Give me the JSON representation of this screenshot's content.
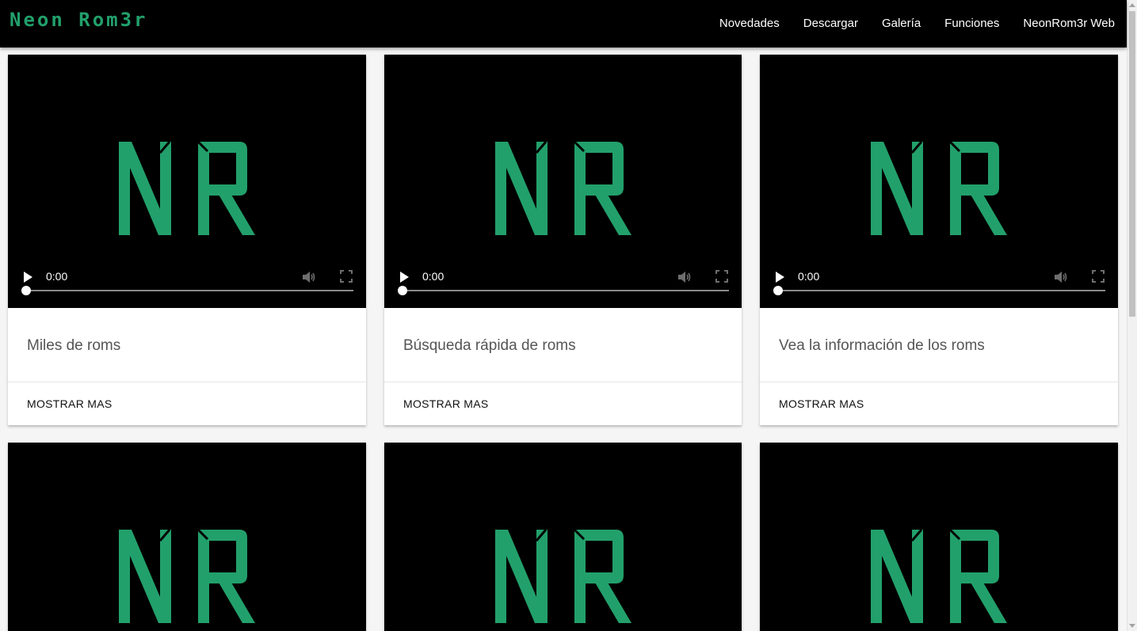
{
  "brand": "Neon Rom3r",
  "nav": {
    "items": [
      {
        "label": "Novedades"
      },
      {
        "label": "Descargar"
      },
      {
        "label": "Galería"
      },
      {
        "label": "Funciones"
      },
      {
        "label": "NeonRom3r Web"
      }
    ]
  },
  "colors": {
    "accent": "#22a06b",
    "navbar": "#000000",
    "video_bg": "#000000"
  },
  "logo": {
    "letters": "NR"
  },
  "player": {
    "time": "0:00",
    "icons": [
      "play-icon",
      "volume-icon",
      "fullscreen-icon"
    ]
  },
  "cards": [
    {
      "title": "Miles de roms",
      "action": "MOSTRAR MAS"
    },
    {
      "title": "Búsqueda rápida de roms",
      "action": "MOSTRAR MAS"
    },
    {
      "title": "Vea la información de los roms",
      "action": "MOSTRAR MAS"
    }
  ]
}
